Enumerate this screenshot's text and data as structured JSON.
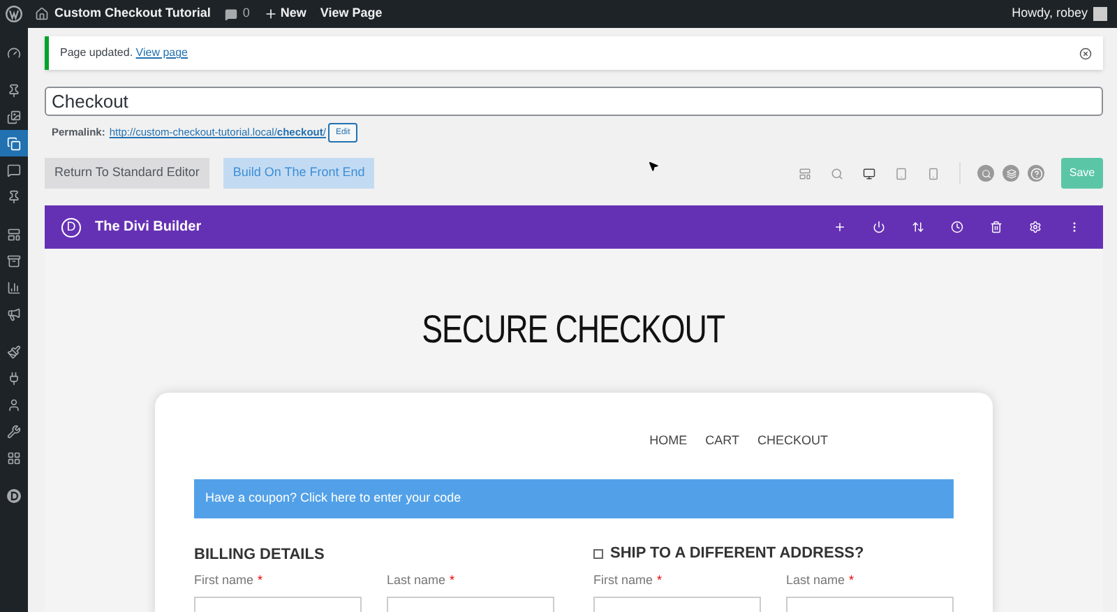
{
  "admin_bar": {
    "site_title": "Custom Checkout Tutorial",
    "comments_count": "0",
    "new_label": "New",
    "view_page": "View Page",
    "greeting": "Howdy, robey"
  },
  "sidebar": {
    "items": [
      {
        "selected": false
      },
      {
        "selected": false
      },
      {
        "selected": false
      },
      {
        "selected": true
      },
      {
        "selected": false
      },
      {
        "selected": false
      },
      {
        "selected": false
      },
      {
        "selected": false
      },
      {
        "selected": false
      },
      {
        "selected": false
      },
      {
        "selected": false
      },
      {
        "selected": false
      },
      {
        "selected": false
      },
      {
        "selected": false
      },
      {
        "selected": false
      },
      {
        "selected": false
      }
    ]
  },
  "notice": {
    "text": "Page updated.",
    "link": "View page"
  },
  "title_field": {
    "value": "Checkout"
  },
  "permalink": {
    "label": "Permalink:",
    "url": "http://custom-checkout-tutorial.local/**checkout**/",
    "edit": "Edit"
  },
  "editor_buttons": [
    {
      "label": "Return To Standard Editor",
      "kind": "default"
    },
    {
      "label": "Build On The Front End",
      "kind": "primary"
    }
  ],
  "save_button": "Save",
  "divi_bar": {
    "logo": "D",
    "title": "The Divi Builder"
  },
  "page": {
    "heading": "SECURE CHECKOUT",
    "nav": [
      "HOME",
      "CART",
      "CHECKOUT"
    ],
    "coupon": "Have a coupon? Click here to enter your code",
    "billing": {
      "title": "BILLING DETAILS",
      "fields": [
        {
          "label": "First name",
          "required_mark": "*"
        },
        {
          "label": "Last name",
          "required_mark": "*"
        }
      ]
    },
    "shipping": {
      "title": "SHIP TO A DIFFERENT ADDRESS?",
      "checked": false,
      "fields": [
        {
          "label": "First name",
          "required_mark": "*"
        },
        {
          "label": "Last name",
          "required_mark": "*"
        }
      ]
    }
  }
}
